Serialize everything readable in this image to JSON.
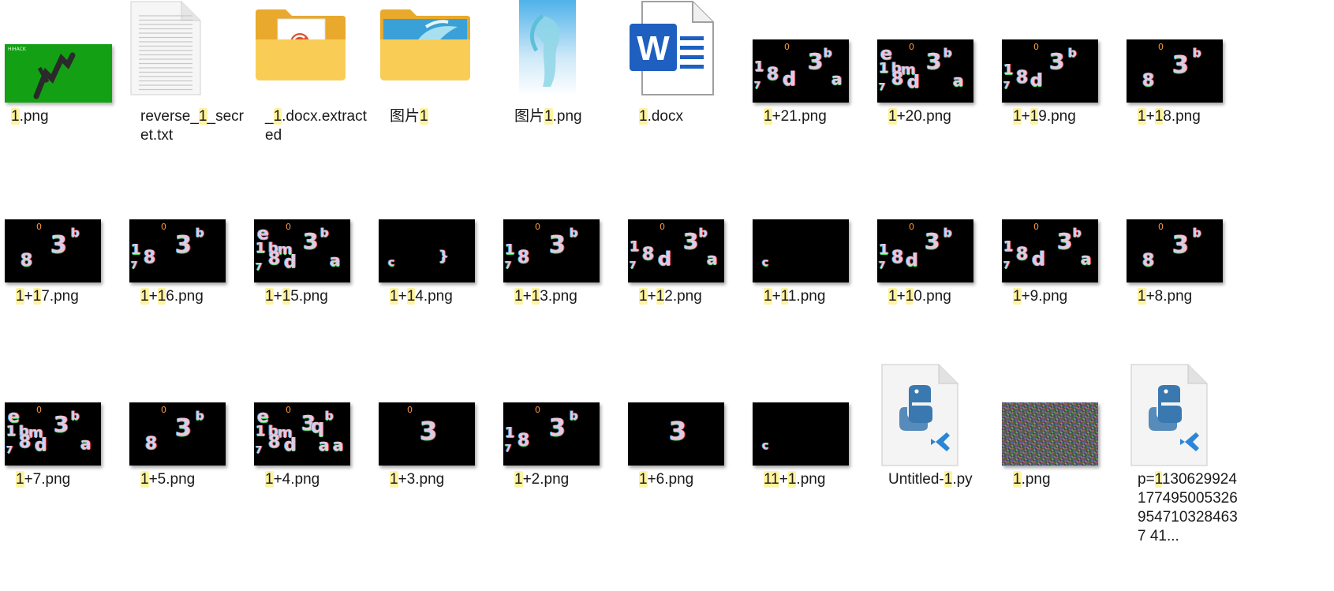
{
  "files": [
    {
      "id": "f1",
      "label_parts": [
        [
          "1",
          true
        ],
        [
          ".png",
          false
        ]
      ],
      "type": "green"
    },
    {
      "id": "f2",
      "label_parts": [
        [
          "reverse_",
          false
        ],
        [
          "1",
          true
        ],
        [
          "_secret.txt",
          false
        ]
      ],
      "type": "txt"
    },
    {
      "id": "f3",
      "label_parts": [
        [
          "_",
          false
        ],
        [
          "1",
          true
        ],
        [
          ".docx.extracted",
          false
        ]
      ],
      "type": "folder-doc"
    },
    {
      "id": "f4",
      "label_parts": [
        [
          "图片",
          false
        ],
        [
          "1",
          true
        ]
      ],
      "type": "folder-pic"
    },
    {
      "id": "f5",
      "label_parts": [
        [
          "图片",
          false
        ],
        [
          "1",
          true
        ],
        [
          ".png",
          false
        ]
      ],
      "type": "photo"
    },
    {
      "id": "f6",
      "label_parts": [
        [
          "1",
          true
        ],
        [
          ".docx",
          false
        ]
      ],
      "type": "word"
    },
    {
      "id": "f7",
      "label_parts": [
        [
          "1",
          true
        ],
        [
          "+21.png",
          false
        ]
      ],
      "type": "dark",
      "glyphs": "full"
    },
    {
      "id": "f8",
      "label_parts": [
        [
          "1",
          true
        ],
        [
          "+20.png",
          false
        ]
      ],
      "type": "dark",
      "glyphs": "fullm"
    },
    {
      "id": "f9",
      "label_parts": [
        [
          "1",
          true
        ],
        [
          "+",
          false
        ],
        [
          "1",
          true
        ],
        [
          "9.png",
          false
        ]
      ],
      "type": "dark",
      "glyphs": "mid"
    },
    {
      "id": "f10",
      "label_parts": [
        [
          "1",
          true
        ],
        [
          "+",
          false
        ],
        [
          "1",
          true
        ],
        [
          "8.png",
          false
        ]
      ],
      "type": "dark",
      "glyphs": "small"
    },
    {
      "id": "f11",
      "label_parts": [
        [
          "1",
          true
        ],
        [
          "+",
          false
        ],
        [
          "1",
          true
        ],
        [
          "7.png",
          false
        ]
      ],
      "type": "dark",
      "glyphs": "small"
    },
    {
      "id": "f12",
      "label_parts": [
        [
          "1",
          true
        ],
        [
          "+",
          false
        ],
        [
          "1",
          true
        ],
        [
          "6.png",
          false
        ]
      ],
      "type": "dark",
      "glyphs": "mid2"
    },
    {
      "id": "f13",
      "label_parts": [
        [
          "1",
          true
        ],
        [
          "+",
          false
        ],
        [
          "1",
          true
        ],
        [
          "5.png",
          false
        ]
      ],
      "type": "dark",
      "glyphs": "fullm"
    },
    {
      "id": "f14",
      "label_parts": [
        [
          "1",
          true
        ],
        [
          "+",
          false
        ],
        [
          "1",
          true
        ],
        [
          "4.png",
          false
        ]
      ],
      "type": "dark",
      "glyphs": "c-brace"
    },
    {
      "id": "f15",
      "label_parts": [
        [
          "1",
          true
        ],
        [
          "+",
          false
        ],
        [
          "1",
          true
        ],
        [
          "3.png",
          false
        ]
      ],
      "type": "dark",
      "glyphs": "mid2"
    },
    {
      "id": "f16",
      "label_parts": [
        [
          "1",
          true
        ],
        [
          "+",
          false
        ],
        [
          "1",
          true
        ],
        [
          "2.png",
          false
        ]
      ],
      "type": "dark",
      "glyphs": "full"
    },
    {
      "id": "f17",
      "label_parts": [
        [
          "1",
          true
        ],
        [
          "+",
          false
        ],
        [
          "1",
          true
        ],
        [
          "1.png",
          false
        ]
      ],
      "type": "dark",
      "glyphs": "c"
    },
    {
      "id": "f18",
      "label_parts": [
        [
          "1",
          true
        ],
        [
          "+",
          false
        ],
        [
          "1",
          true
        ],
        [
          "0.png",
          false
        ]
      ],
      "type": "dark",
      "glyphs": "mid"
    },
    {
      "id": "f19",
      "label_parts": [
        [
          "1",
          true
        ],
        [
          "+9.png",
          false
        ]
      ],
      "type": "dark",
      "glyphs": "full"
    },
    {
      "id": "f20",
      "label_parts": [
        [
          "1",
          true
        ],
        [
          "+8.png",
          false
        ]
      ],
      "type": "dark",
      "glyphs": "small"
    },
    {
      "id": "f21",
      "label_parts": [
        [
          "1",
          true
        ],
        [
          "+7.png",
          false
        ]
      ],
      "type": "dark",
      "glyphs": "fullm"
    },
    {
      "id": "f22",
      "label_parts": [
        [
          "1",
          true
        ],
        [
          "+5.png",
          false
        ]
      ],
      "type": "dark",
      "glyphs": "small"
    },
    {
      "id": "f23",
      "label_parts": [
        [
          "1",
          true
        ],
        [
          "+4.png",
          false
        ]
      ],
      "type": "dark",
      "glyphs": "fullmq"
    },
    {
      "id": "f24",
      "label_parts": [
        [
          "1",
          true
        ],
        [
          "+3.png",
          false
        ]
      ],
      "type": "dark",
      "glyphs": "zero3"
    },
    {
      "id": "f25",
      "label_parts": [
        [
          "1",
          true
        ],
        [
          "+2.png",
          false
        ]
      ],
      "type": "dark",
      "glyphs": "mid2"
    },
    {
      "id": "f26",
      "label_parts": [
        [
          "1",
          true
        ],
        [
          "+6.png",
          false
        ]
      ],
      "type": "dark",
      "glyphs": "three"
    },
    {
      "id": "f27",
      "label_parts": [
        [
          "11",
          true
        ],
        [
          "+",
          false
        ],
        [
          "1",
          true
        ],
        [
          ".png",
          false
        ]
      ],
      "type": "dark",
      "glyphs": "c"
    },
    {
      "id": "f28",
      "label_parts": [
        [
          "Untitled-",
          false
        ],
        [
          "1",
          true
        ],
        [
          ".py",
          false
        ]
      ],
      "type": "py"
    },
    {
      "id": "f29",
      "label_parts": [
        [
          "1",
          true
        ],
        [
          ".png",
          false
        ]
      ],
      "type": "noise"
    },
    {
      "id": "f30",
      "label_parts": [
        [
          "p=",
          false
        ],
        [
          "1",
          true
        ],
        [
          "1306299241774950053269547103284637 41...",
          false
        ]
      ],
      "type": "py"
    }
  ],
  "colors": {
    "highlight": "#fff3a0",
    "folder": "#f7c948",
    "word_blue": "#1e5fbf",
    "python_blue": "#3a78b0"
  }
}
